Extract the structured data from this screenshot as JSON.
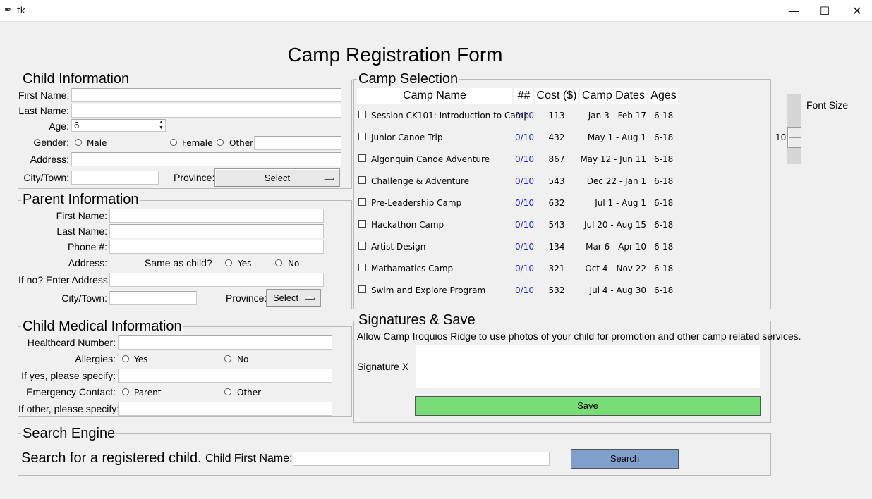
{
  "window": {
    "title": "tk",
    "icon": "feather-icon",
    "minimize": "—",
    "maximize": "☐",
    "close": "✕"
  },
  "form_title": "Camp Registration Form",
  "child_info": {
    "legend": "Child Information",
    "first_name_label": "First Name:",
    "last_name_label": "Last Name:",
    "age_label": "Age:",
    "age_value": "6",
    "gender_label": "Gender:",
    "gender_options": [
      "Male",
      "Female",
      "Other"
    ],
    "address_label": "Address:",
    "city_label": "City/Town:",
    "province_label": "Province:",
    "province_value": "Select"
  },
  "parent_info": {
    "legend": "Parent Information",
    "first_name_label": "First Name:",
    "last_name_label": "Last Name:",
    "phone_label": "Phone #:",
    "address_label": "Address:",
    "same_as_child_label": "Same as child?",
    "same_options": [
      "Yes",
      "No"
    ],
    "if_no_label": "If no? Enter Address:",
    "city_label": "City/Town:",
    "province_label": "Province:",
    "province_value": "Select"
  },
  "medical": {
    "legend": "Child Medical Information",
    "healthcard_label": "Healthcard Number:",
    "allergies_label": "Allergies:",
    "allergy_options": [
      "Yes",
      "No"
    ],
    "if_yes_label": "If yes, please specify:",
    "emergency_label": "Emergency Contact:",
    "emergency_options": [
      "Parent",
      "Other"
    ],
    "if_other_label": "If other, please specify:"
  },
  "camp_selection": {
    "legend": "Camp Selection",
    "headers": {
      "name": "Camp Name",
      "count": "##",
      "cost": "Cost ($)",
      "dates": "Camp Dates",
      "ages": "Ages"
    },
    "camps": [
      {
        "name": "Session CK101: Introduction to Camp",
        "count": "0/10",
        "cost": "113",
        "dates": "Jan 3 - Feb 17",
        "ages": "6-18"
      },
      {
        "name": "Junior Canoe Trip",
        "count": "0/10",
        "cost": "432",
        "dates": "May 1 - Aug 1",
        "ages": "6-18"
      },
      {
        "name": "Algonquin Canoe Adventure",
        "count": "0/10",
        "cost": "867",
        "dates": "May 12 - Jun 11",
        "ages": "6-18"
      },
      {
        "name": "Challenge & Adventure",
        "count": "0/10",
        "cost": "543",
        "dates": "Dec 22 - Jan 1",
        "ages": "6-18"
      },
      {
        "name": "Pre-Leadership Camp",
        "count": "0/10",
        "cost": "632",
        "dates": "Jul 1 - Aug 1",
        "ages": "6-18"
      },
      {
        "name": "Hackathon Camp",
        "count": "0/10",
        "cost": "543",
        "dates": "Jul 20 - Aug 15",
        "ages": "6-18"
      },
      {
        "name": "Artist Design",
        "count": "0/10",
        "cost": "134",
        "dates": "Mar 6 - Apr 10",
        "ages": "6-18"
      },
      {
        "name": "Mathamatics Camp",
        "count": "0/10",
        "cost": "321",
        "dates": "Oct 4 - Nov 22",
        "ages": "6-18"
      },
      {
        "name": "Swim and Explore Program",
        "count": "0/10",
        "cost": "532",
        "dates": "Jul 4 - Aug 30",
        "ages": "6-18"
      }
    ]
  },
  "signatures": {
    "legend": "Signatures & Save",
    "consent_text": "Allow Camp Iroquios Ridge to use photos of your child for promotion and other camp related services.",
    "signature_label": "Signature X",
    "save_label": "Save"
  },
  "search": {
    "legend": "Search Engine",
    "heading": "Search for a registered child.",
    "field_label": "Child First Name:",
    "button_label": "Search"
  },
  "font_size": {
    "label": "Font Size",
    "value": "10"
  },
  "colors": {
    "save": "#77dd77",
    "search": "#7f9fcc",
    "count_text": "#1a24c8"
  }
}
